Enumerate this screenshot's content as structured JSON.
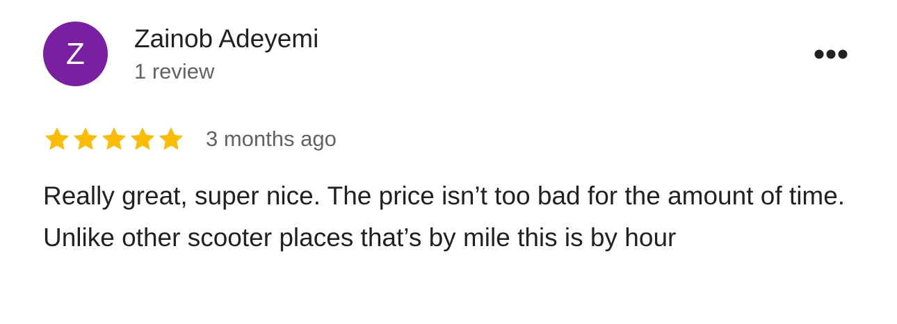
{
  "review": {
    "author": {
      "initial": "Z",
      "name": "Zainob Adeyemi",
      "review_count": "1 review",
      "avatar_color": "#7b1fa2"
    },
    "rating": {
      "stars": 5,
      "max_stars": 5,
      "star_color": "#fbbc04"
    },
    "date": "3 months ago",
    "text": "Really great, super nice. The price isn’t too bad for the amount of time. Unlike other scooter places that’s by mile this is by hour",
    "more_icon": "more-horizontal-icon"
  }
}
